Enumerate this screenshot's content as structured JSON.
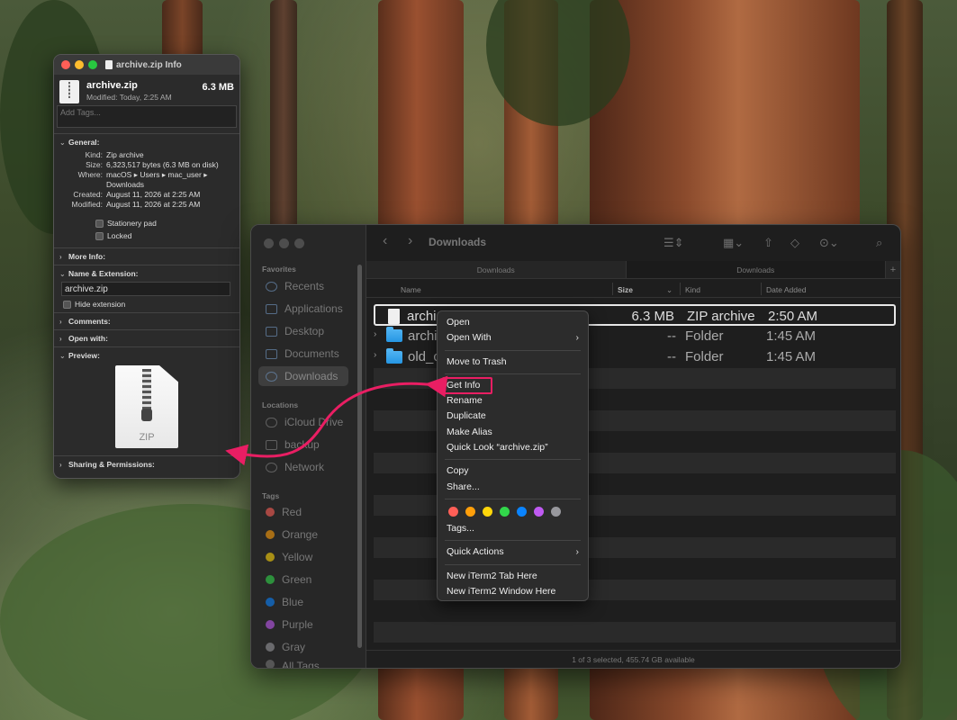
{
  "info_window": {
    "title": "archive.zip Info",
    "file_name": "archive.zip",
    "file_size": "6.3 MB",
    "modified_short": "Modified: Today, 2:25 AM",
    "tags_placeholder": "Add Tags...",
    "general": {
      "header": "General:",
      "rows": [
        {
          "k": "Kind:",
          "v": "Zip archive"
        },
        {
          "k": "Size:",
          "v": "6,323,517 bytes (6.3 MB on disk)"
        },
        {
          "k": "Where:",
          "v": "macOS ▸ Users ▸ mac_user ▸ Downloads"
        },
        {
          "k": "Created:",
          "v": "August 11, 2026 at 2:25 AM"
        },
        {
          "k": "Modified:",
          "v": "August 11, 2026 at 2:25 AM"
        }
      ],
      "stationery": "Stationery pad",
      "locked": "Locked"
    },
    "more_info": "More Info:",
    "name_ext": "Name & Extension:",
    "name_value": "archive.zip",
    "hide_ext": "Hide extension",
    "comments": "Comments:",
    "open_with": "Open with:",
    "preview": "Preview:",
    "preview_label": "ZIP",
    "sharing": "Sharing & Permissions:"
  },
  "finder": {
    "title": "Downloads",
    "tabs": [
      "Downloads",
      "Downloads"
    ],
    "columns": {
      "name": "Name",
      "size": "Size",
      "kind": "Kind",
      "date": "Date Added"
    },
    "sidebar": {
      "favorites_label": "Favorites",
      "favorites": [
        "Recents",
        "Applications",
        "Desktop",
        "Documents",
        "Downloads"
      ],
      "locations_label": "Locations",
      "locations": [
        "iCloud Drive",
        "backup",
        "Network"
      ],
      "tags_label": "Tags",
      "tags": [
        {
          "name": "Red",
          "color": "#ff5f57"
        },
        {
          "name": "Orange",
          "color": "#ff9f0a"
        },
        {
          "name": "Yellow",
          "color": "#ffd60a"
        },
        {
          "name": "Green",
          "color": "#32d74b"
        },
        {
          "name": "Blue",
          "color": "#0a84ff"
        },
        {
          "name": "Purple",
          "color": "#bf5af2"
        },
        {
          "name": "Gray",
          "color": "#98989d"
        }
      ],
      "all_tags": "All Tags..."
    },
    "rows": [
      {
        "name": "archi",
        "size": "6.3 MB",
        "kind": "ZIP archive",
        "date": "2:50 AM"
      },
      {
        "name": "archi",
        "size": "--",
        "kind": "Folder",
        "date": "1:45 AM"
      },
      {
        "name": "old_c",
        "size": "--",
        "kind": "Folder",
        "date": "1:45 AM"
      }
    ],
    "status": "1 of 3 selected, 455.74 GB available"
  },
  "context_menu": {
    "open": "Open",
    "open_with": "Open With",
    "move_to_trash": "Move to Trash",
    "get_info": "Get Info",
    "rename": "Rename",
    "duplicate": "Duplicate",
    "make_alias": "Make Alias",
    "quick_look": "Quick Look “archive.zip”",
    "copy": "Copy",
    "share": "Share...",
    "tag_colors": [
      "#ff5f57",
      "#ff9f0a",
      "#ffd60a",
      "#32d74b",
      "#0a84ff",
      "#bf5af2",
      "#98989d"
    ],
    "tags": "Tags...",
    "quick_actions": "Quick Actions",
    "new_iterm_tab": "New iTerm2 Tab Here",
    "new_iterm_window": "New iTerm2 Window Here"
  },
  "annotation_color": "#e91e63"
}
